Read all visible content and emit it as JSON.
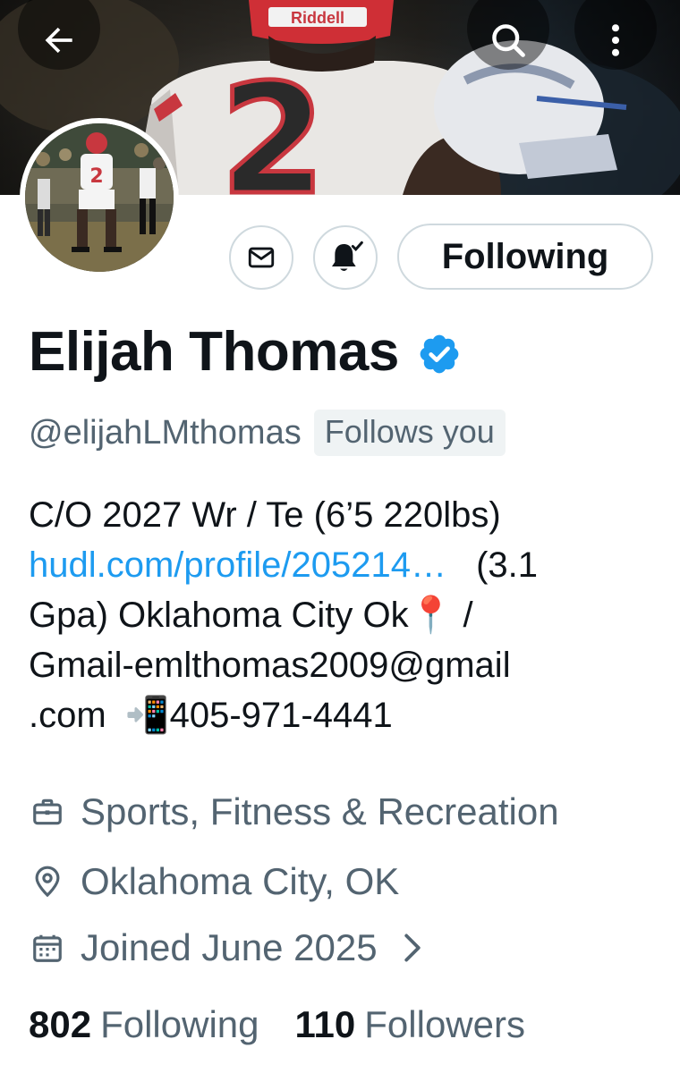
{
  "header": {
    "back_icon": "arrow-left-icon",
    "search_icon": "search-icon",
    "more_icon": "more-vertical-icon",
    "banner_helmet_text": "Riddell",
    "banner_jersey_number": "2"
  },
  "profile": {
    "name": "Elijah Thomas",
    "verified_icon": "verified-badge-icon",
    "verified_color": "#1d9bf0",
    "handle": "@elijahLMthomas",
    "follows_you": "Follows you",
    "avatar_jersey_number": "2"
  },
  "actions": {
    "message_icon": "mail-icon",
    "notify_icon": "bell-check-icon",
    "follow_label": "Following"
  },
  "bio": {
    "line1": "C/O 2027 Wr / Te (6’5 220lbs)",
    "link": "hudl.com/profile/205214…",
    "line2_rest": "(3.1",
    "line3": "Gpa) Oklahoma City Ok📍 /",
    "line4": "Gmail-emlthomas2009@gmail",
    "line5_pre": ".com",
    "line5_emoji": "📲",
    "line5_post": "405-971-4441"
  },
  "meta": {
    "category_icon": "briefcase-icon",
    "category": "Sports, Fitness & Recreation",
    "location_icon": "location-pin-icon",
    "location": "Oklahoma City, OK",
    "joined_icon": "calendar-icon",
    "joined": "Joined June 2025",
    "joined_chevron_icon": "chevron-right-icon"
  },
  "stats": {
    "following_count": "802",
    "following_label": "Following",
    "followers_count": "110",
    "followers_label": "Followers"
  },
  "colors": {
    "link": "#1d9bf0",
    "secondary_text": "#536471",
    "primary_text": "#0f1419",
    "border": "#cfd9de"
  }
}
